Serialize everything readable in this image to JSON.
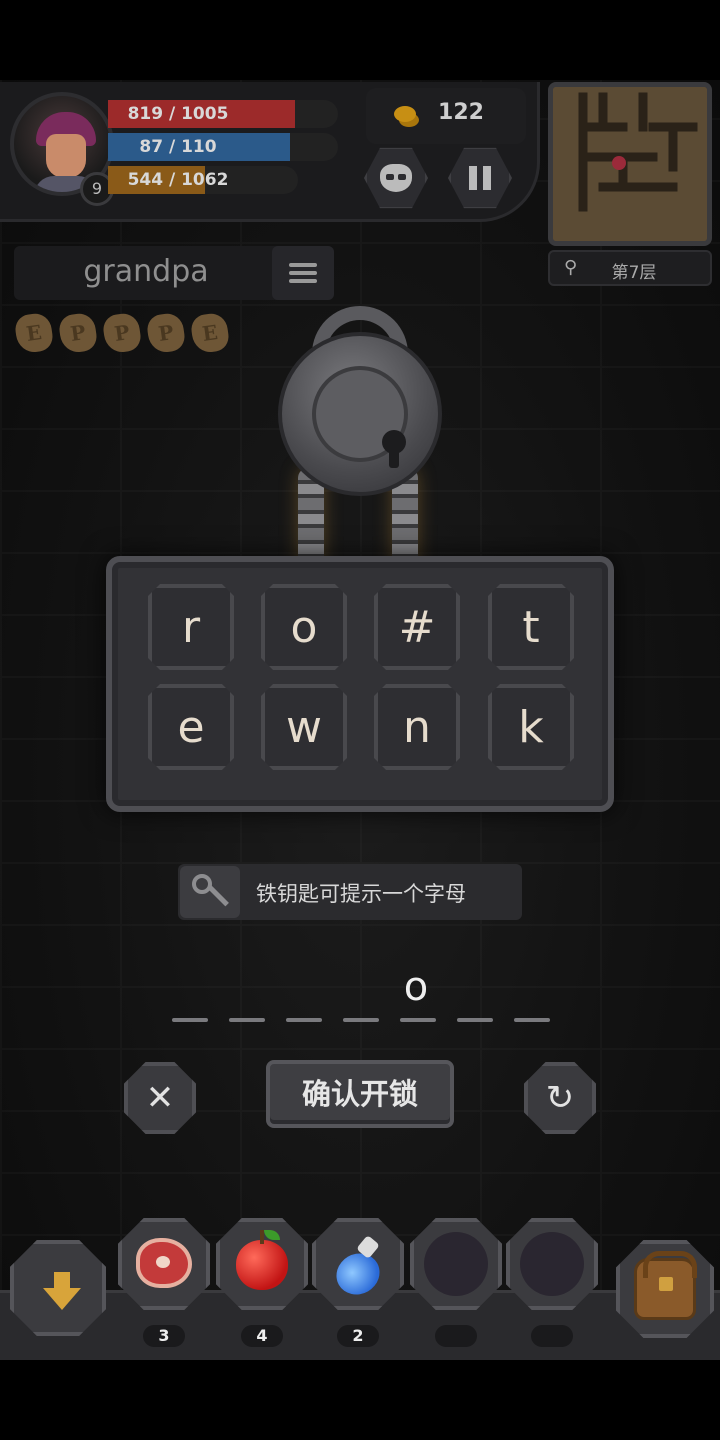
{
  "hud": {
    "level": "9",
    "hp": {
      "text": "819 / 1005",
      "value": 819,
      "max": 1005
    },
    "mp": {
      "text": "87 / 110",
      "value": 87,
      "max": 110
    },
    "xp": {
      "text": "544 / 1062",
      "value": 544,
      "max": 1062
    },
    "gold": "122",
    "floor": "第7层"
  },
  "word_panel": {
    "word": "grandpa",
    "runes": [
      "E",
      "P",
      "P",
      "P",
      "E"
    ]
  },
  "puzzle": {
    "tiles": [
      "r",
      "o",
      "#",
      "t",
      "e",
      "w",
      "n",
      "k"
    ],
    "hint": "铁钥匙可提示一个字母",
    "answer_letter": "o",
    "slot_count": 7,
    "confirm_label": "确认开锁",
    "clear_symbol": "✕",
    "reset_symbol": "↻"
  },
  "inventory": [
    {
      "name": "meat",
      "count": "3"
    },
    {
      "name": "apple",
      "count": "4"
    },
    {
      "name": "potion",
      "count": "2"
    },
    {
      "name": "empty",
      "count": ""
    },
    {
      "name": "empty",
      "count": ""
    }
  ],
  "colors": {
    "hp": "#9c2a2a",
    "mp": "#2b5a8a",
    "xp": "#8a5a18",
    "gold": "#c78f14"
  }
}
